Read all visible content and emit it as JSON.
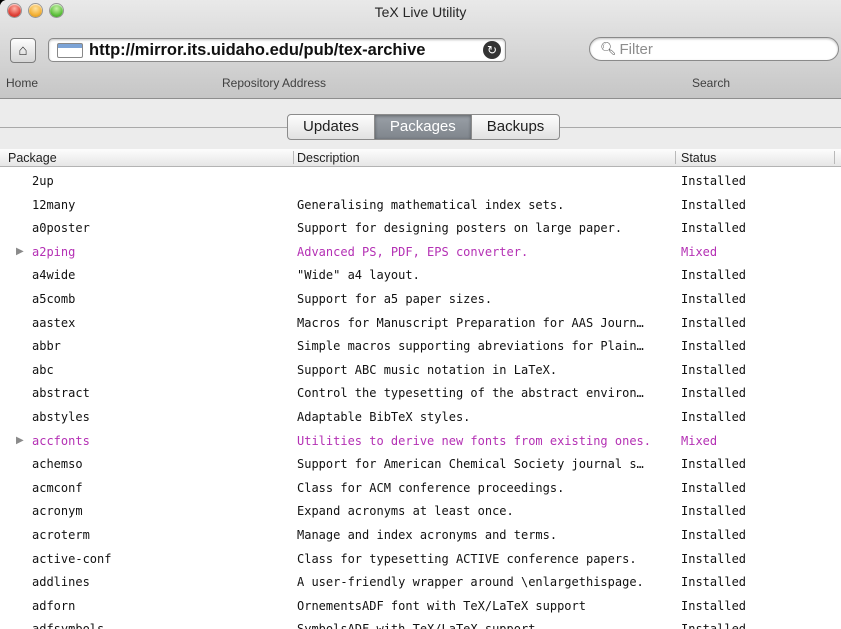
{
  "window": {
    "title": "TeX Live Utility"
  },
  "toolbar": {
    "home_label": "Home",
    "address": "http://mirror.its.uidaho.edu/pub/tex-archive",
    "address_label": "Repository Address",
    "search_placeholder": "Filter",
    "search_label": "Search"
  },
  "tabs": [
    {
      "label": "Updates",
      "selected": false
    },
    {
      "label": "Packages",
      "selected": true
    },
    {
      "label": "Backups",
      "selected": false
    }
  ],
  "table": {
    "columns": [
      "Package",
      "Description",
      "Status"
    ],
    "rows": [
      {
        "name": "2up",
        "description": "",
        "status": "Installed"
      },
      {
        "name": "12many",
        "description": "Generalising mathematical index sets.",
        "status": "Installed"
      },
      {
        "name": "a0poster",
        "description": "Support for designing posters on large paper.",
        "status": "Installed"
      },
      {
        "name": "a2ping",
        "description": "Advanced PS, PDF, EPS converter.",
        "status": "Mixed",
        "expandable": true
      },
      {
        "name": "a4wide",
        "description": "\"Wide\" a4 layout.",
        "status": "Installed"
      },
      {
        "name": "a5comb",
        "description": "Support for a5 paper sizes.",
        "status": "Installed"
      },
      {
        "name": "aastex",
        "description": "Macros for Manuscript Preparation for AAS Journ…",
        "status": "Installed"
      },
      {
        "name": "abbr",
        "description": "Simple macros supporting abreviations for Plain…",
        "status": "Installed"
      },
      {
        "name": "abc",
        "description": "Support ABC music notation in LaTeX.",
        "status": "Installed"
      },
      {
        "name": "abstract",
        "description": "Control the typesetting of the abstract environ…",
        "status": "Installed"
      },
      {
        "name": "abstyles",
        "description": "Adaptable BibTeX styles.",
        "status": "Installed"
      },
      {
        "name": "accfonts",
        "description": "Utilities to derive new fonts from existing ones.",
        "status": "Mixed",
        "expandable": true
      },
      {
        "name": "achemso",
        "description": "Support for American Chemical Society journal s…",
        "status": "Installed"
      },
      {
        "name": "acmconf",
        "description": "Class for ACM conference proceedings.",
        "status": "Installed"
      },
      {
        "name": "acronym",
        "description": "Expand acronyms at least once.",
        "status": "Installed"
      },
      {
        "name": "acroterm",
        "description": "Manage and index acronyms and terms.",
        "status": "Installed"
      },
      {
        "name": "active-conf",
        "description": "Class for typesetting ACTIVE conference papers.",
        "status": "Installed"
      },
      {
        "name": "addlines",
        "description": "A user-friendly wrapper around \\enlargethispage.",
        "status": "Installed"
      },
      {
        "name": "adforn",
        "description": "OrnementsADF font with TeX/LaTeX support",
        "status": "Installed"
      },
      {
        "name": "adfsymbols",
        "description": "SymbolsADF with TeX/LaTeX support.",
        "status": "Installed"
      }
    ]
  },
  "colors": {
    "mixed_status": "#b430b4",
    "selected_tab": "#8a9097"
  },
  "icons": [
    "close-icon",
    "minimize-icon",
    "zoom-icon",
    "home-icon",
    "url-icon",
    "reload-icon",
    "magnifier-icon",
    "disclosure-triangle-icon"
  ]
}
